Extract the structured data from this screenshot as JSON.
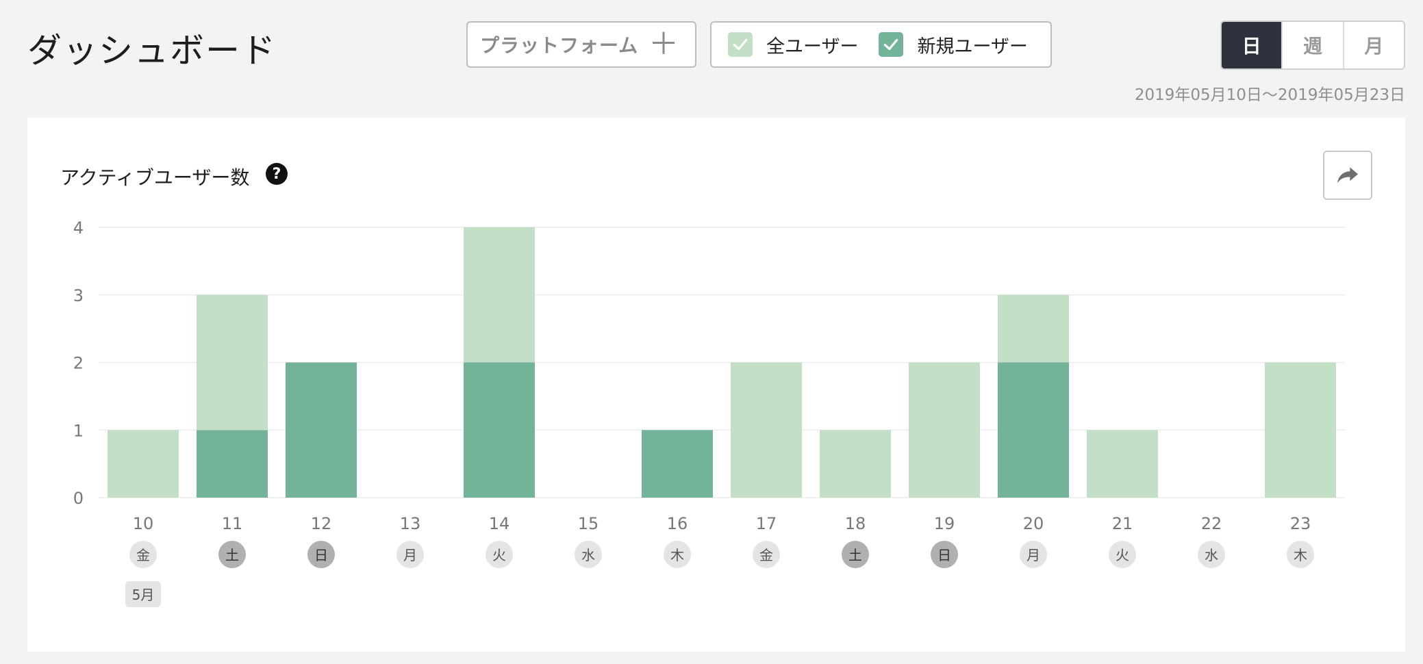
{
  "header": {
    "title": "ダッシュボード",
    "platform_label": "プラットフォーム",
    "platform_plus": "＋",
    "legend": [
      {
        "label": "全ユーザー",
        "color": "#c3dfc5"
      },
      {
        "label": "新規ユーザー",
        "color": "#72b39a"
      }
    ],
    "period_options": [
      "日",
      "週",
      "月"
    ],
    "period_active": "日",
    "date_range": "2019年05月10日〜2019年05月23日"
  },
  "card": {
    "title": "アクティブユーザー数",
    "help_icon": "?",
    "share_icon": "share-arrow-icon"
  },
  "chart_data": {
    "type": "bar",
    "stacked": true,
    "categories": [
      "10",
      "11",
      "12",
      "13",
      "14",
      "15",
      "16",
      "17",
      "18",
      "19",
      "20",
      "21",
      "22",
      "23"
    ],
    "weekdays": [
      "金",
      "土",
      "日",
      "月",
      "火",
      "水",
      "木",
      "金",
      "土",
      "日",
      "月",
      "火",
      "水",
      "木"
    ],
    "weekend": [
      false,
      true,
      true,
      false,
      false,
      false,
      false,
      false,
      true,
      true,
      false,
      false,
      false,
      false
    ],
    "month_label": "5月",
    "series": [
      {
        "name": "新規ユーザー",
        "color": "#72b39a",
        "values": [
          0,
          1,
          2,
          0,
          2,
          0,
          1,
          0,
          0,
          0,
          2,
          0,
          0,
          0
        ]
      },
      {
        "name": "全ユーザー",
        "color": "#c3dfc5",
        "values": [
          1,
          2,
          0,
          0,
          2,
          0,
          0,
          2,
          1,
          2,
          1,
          1,
          0,
          2
        ]
      }
    ],
    "ylim": [
      0,
      4
    ],
    "yticks": [
      "0",
      "1",
      "2",
      "3",
      "4"
    ],
    "grid": true
  }
}
